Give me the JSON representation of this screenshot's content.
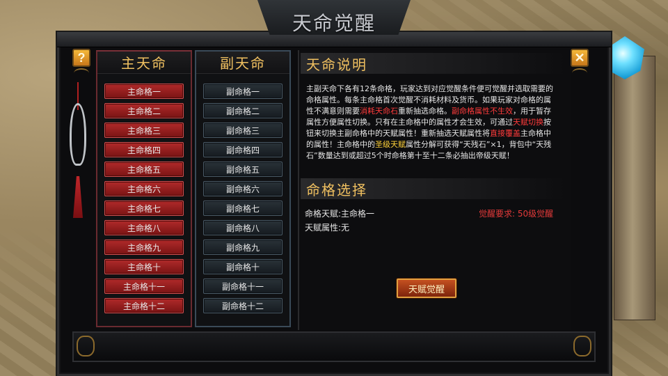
{
  "window": {
    "title": "天命觉醒",
    "help_label": "?",
    "close_label": "✕"
  },
  "main_column": {
    "header": "主天命",
    "items": [
      "主命格一",
      "主命格二",
      "主命格三",
      "主命格四",
      "主命格五",
      "主命格六",
      "主命格七",
      "主命格八",
      "主命格九",
      "主命格十",
      "主命格十一",
      "主命格十二"
    ]
  },
  "sub_column": {
    "header": "副天命",
    "items": [
      "副命格一",
      "副命格二",
      "副命格三",
      "副命格四",
      "副命格五",
      "副命格六",
      "副命格七",
      "副命格八",
      "副命格九",
      "副命格十",
      "副命格十一",
      "副命格十二"
    ]
  },
  "description": {
    "header": "天命说明",
    "segments": [
      {
        "text": "主副天命下各有12条命格，玩家达到对应觉醒条件便可觉醒并选取需要的命格属性。每条主命格首次觉醒不消耗材料及货币。如果玩家对命格的属性不满意则需要",
        "color": "normal"
      },
      {
        "text": "消耗天命石",
        "color": "red"
      },
      {
        "text": "重新抽选命格。",
        "color": "normal"
      },
      {
        "text": "副命格属性不生效",
        "color": "red"
      },
      {
        "text": "，用于暂存属性方便属性切换。只有在主命格中的属性才会生效，可通过",
        "color": "normal"
      },
      {
        "text": "天赋切换",
        "color": "red"
      },
      {
        "text": "按钮来切换主副命格中的天赋属性！重新抽选天赋属性将",
        "color": "normal"
      },
      {
        "text": "直接覆盖",
        "color": "red"
      },
      {
        "text": "主命格中的属性！主命格中的",
        "color": "normal"
      },
      {
        "text": "圣级天赋",
        "color": "yellow"
      },
      {
        "text": "属性分解可获得“天残石”×1，背包中“天残石”数量达到或超过5个时命格第十至十二条必抽出帝级天赋！",
        "color": "normal"
      }
    ]
  },
  "selection": {
    "header": "命格选择",
    "talent_label": "命格天赋:主命格一",
    "requirement": "觉醒要求: 50级觉醒",
    "attribute_label": "天赋属性:无",
    "awaken_button": "天赋觉醒"
  },
  "colors": {
    "gold_header": "#f0c060",
    "main_slot": "#b02a2a",
    "sub_slot": "#2a3238",
    "highlight_red": "#ff3b3b",
    "highlight_yellow": "#ffd23a"
  }
}
